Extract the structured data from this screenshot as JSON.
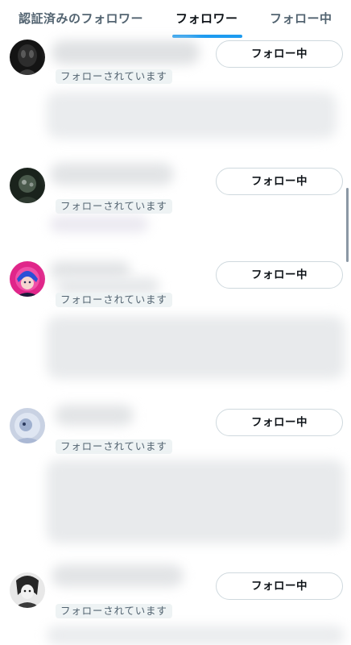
{
  "tabs": [
    {
      "label": "認証済みのフォロワー",
      "active": false
    },
    {
      "label": "フォロワー",
      "active": true
    },
    {
      "label": "フォロー中",
      "active": false
    }
  ],
  "colors": {
    "accent": "#1d9bf0",
    "text_primary": "#0f1419",
    "text_secondary": "#536471",
    "badge_background": "#eef3f4",
    "button_border": "#cfd9de"
  },
  "users": [
    {
      "avatar": "dark-monochrome-avatar",
      "follows_you_label": "フォローされています",
      "follow_button_label": "フォロー中"
    },
    {
      "avatar": "dark-green-avatar",
      "follows_you_label": "フォローされています",
      "follow_button_label": "フォロー中"
    },
    {
      "avatar": "anime-blue-hair-avatar",
      "follows_you_label": "フォローされています",
      "follow_button_label": "フォロー中"
    },
    {
      "avatar": "pale-blue-illustration-avatar",
      "follows_you_label": "フォローされています",
      "follow_button_label": "フォロー中"
    },
    {
      "avatar": "monochrome-anime-avatar",
      "follows_you_label": "フォローされています",
      "follow_button_label": "フォロー中"
    }
  ]
}
